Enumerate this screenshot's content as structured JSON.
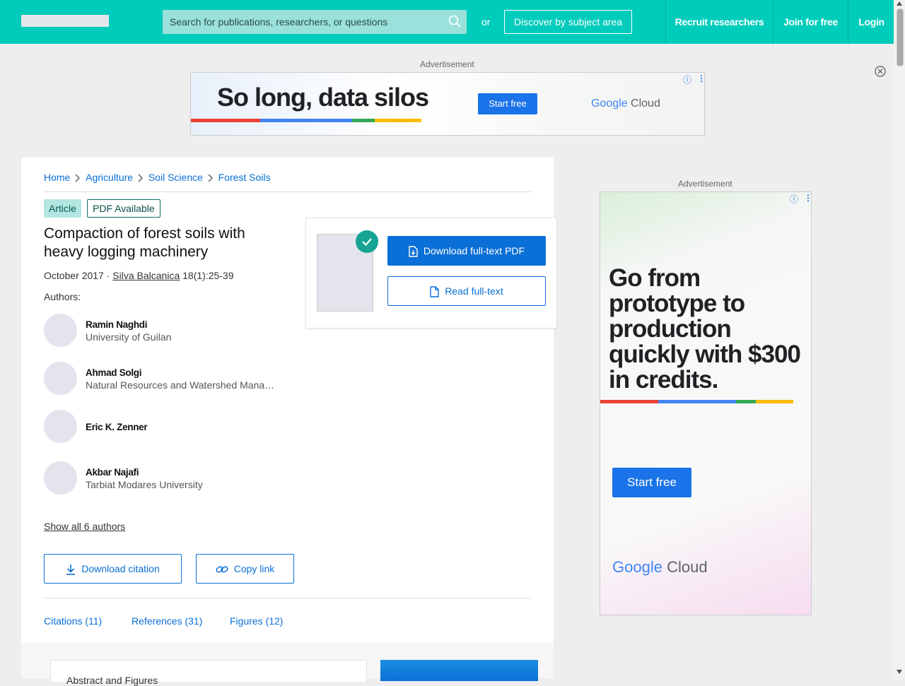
{
  "header": {
    "search_placeholder": "Search for publications, researchers, or questions",
    "or_label": "or",
    "discover_label": "Discover by subject area",
    "recruit_label": "Recruit researchers",
    "join_label": "Join for free",
    "login_label": "Login"
  },
  "ads": {
    "label": "Advertisement",
    "top": {
      "headline": "So long, data silos",
      "cta": "Start free",
      "brand_google": "Google",
      "brand_cloud": "Cloud"
    },
    "side": {
      "headline": "Go from prototype to production quickly with $300 in credits.",
      "cta": "Start free",
      "brand_google": "Google",
      "brand_cloud": "Cloud"
    }
  },
  "breadcrumb": [
    "Home",
    "Agriculture",
    "Soil Science",
    "Forest Soils"
  ],
  "article": {
    "type_badge": "Article",
    "pdf_badge": "PDF Available",
    "title": "Compaction of forest soils with heavy logging machinery",
    "date": "October 2017",
    "separator": "·",
    "journal": "Silva Balcanica",
    "volume": "18(1):25-39",
    "authors_label": "Authors:",
    "authors": [
      {
        "name": "Ramin Naghdi",
        "affiliation": "University of Guilan"
      },
      {
        "name": "Ahmad Solgi",
        "affiliation": "Natural Resources and Watershed Manag..."
      },
      {
        "name": "Eric K. Zenner",
        "affiliation": ""
      },
      {
        "name": "Akbar Najafi",
        "affiliation": "Tarbiat Modares University"
      }
    ],
    "show_all": "Show all 6 authors",
    "download_citation": "Download citation",
    "copy_link": "Copy link"
  },
  "tabs": [
    "Citations (11)",
    "References (31)",
    "Figures (12)"
  ],
  "abstract_heading": "Abstract and Figures",
  "download_panel": {
    "download_pdf": "Download full-text PDF",
    "read_full": "Read full-text"
  },
  "colors": {
    "header": "#00ccbb",
    "link": "#0a6fd6",
    "check": "#16a394",
    "ad_blue": "#1a73e8"
  }
}
